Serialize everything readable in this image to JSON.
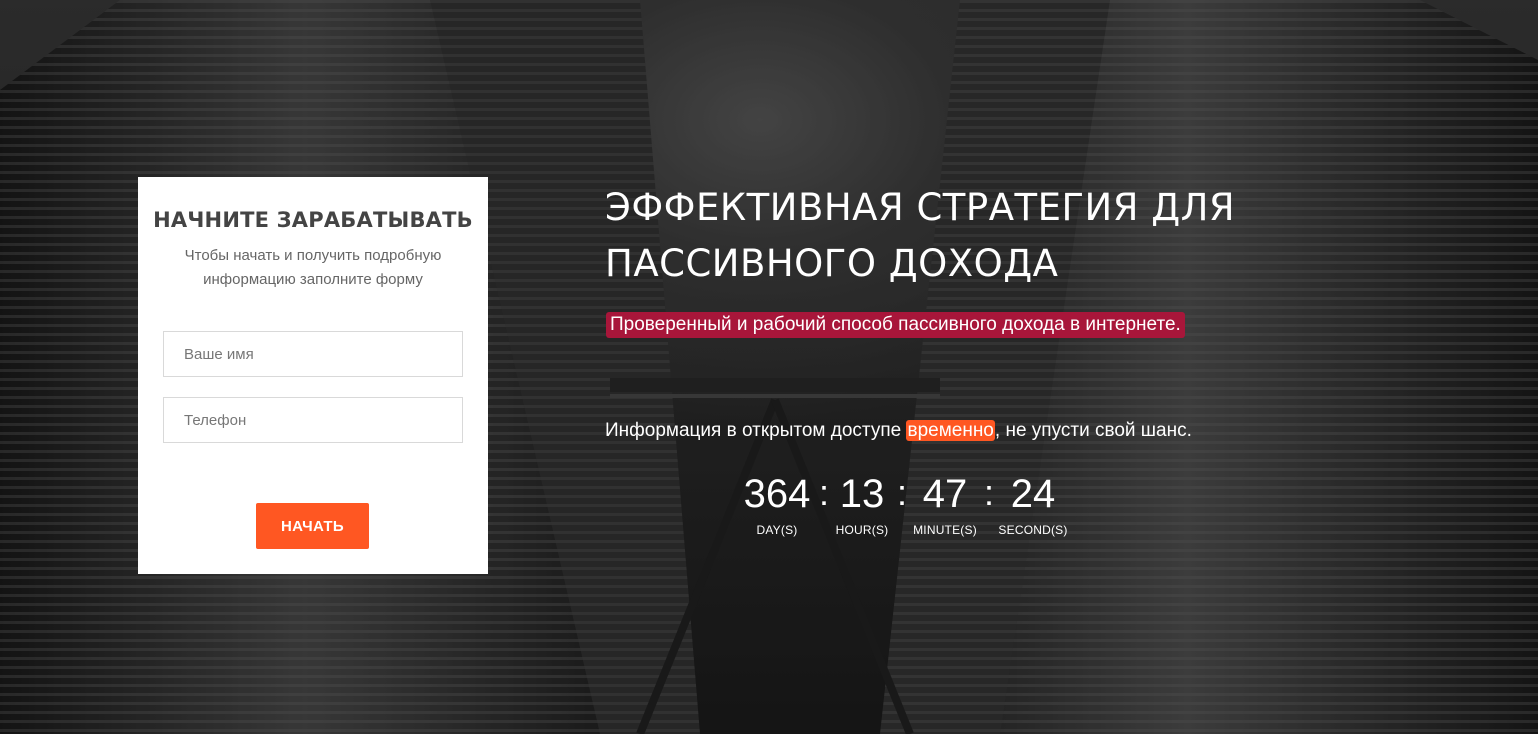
{
  "form": {
    "title": "НАЧНИТЕ ЗАРАБАТЫВАТЬ",
    "subtitle": "Чтобы начать и получить подробную информацию заполните форму",
    "name_placeholder": "Ваше имя",
    "phone_placeholder": "Телефон",
    "name_value": "",
    "phone_value": "",
    "submit_label": "НАЧАТЬ"
  },
  "hero": {
    "headline_line1": "ЭФФЕКТИВНАЯ СТРАТЕГИЯ ДЛЯ",
    "headline_line2": "ПАССИВНОГО ДОХОДА",
    "tagline": "Проверенный и рабочий способ пассивного дохода в интернете.",
    "info_before": "Информация в открытом доступе ",
    "info_highlight": "временно",
    "info_after": ", не упусти свой шанс."
  },
  "countdown": {
    "days": "364",
    "hours": "13",
    "minutes": "47",
    "seconds": "24",
    "separator": ":",
    "days_label": "DAY(S)",
    "hours_label": "HOUR(S)",
    "minutes_label": "MINUTE(S)",
    "seconds_label": "SECOND(S)"
  },
  "colors": {
    "accent": "#ff5722",
    "tagline_bg": "#a8163a",
    "card_bg": "#ffffff",
    "background": "#262626"
  },
  "icons": {
    "background": "twin-towers-photo"
  }
}
